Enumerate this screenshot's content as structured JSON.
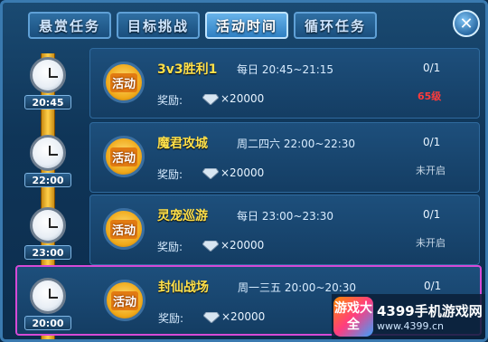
{
  "tabs": [
    {
      "label": "悬赏任务",
      "active": false
    },
    {
      "label": "目标挑战",
      "active": false
    },
    {
      "label": "活动时间",
      "active": true
    },
    {
      "label": "循环任务",
      "active": false
    }
  ],
  "close_label": "✕",
  "badge_text": "活动",
  "reward_label": "奖励:",
  "activities": [
    {
      "time": "20:45",
      "title": "3v3胜利1",
      "schedule": "每日 20:45~21:15",
      "count": "0/1",
      "status": "65级",
      "status_color": "#ff3b3b",
      "reward": "×20000"
    },
    {
      "time": "22:00",
      "title": "魔君攻城",
      "schedule": "周二四六 22:00~22:30",
      "count": "0/1",
      "status": "未开启",
      "status_color": "#c9d9e8",
      "reward": "×20000"
    },
    {
      "time": "23:00",
      "title": "灵宠巡游",
      "schedule": "每日 23:00~23:30",
      "count": "0/1",
      "status": "未开启",
      "status_color": "#c9d9e8",
      "reward": "×20000"
    },
    {
      "time": "20:00",
      "title": "封仙战场",
      "schedule": "周一三五 20:00~20:30",
      "count": "0/1",
      "status": "",
      "status_color": "#c9d9e8",
      "reward": "×20000"
    }
  ],
  "watermark": {
    "logo_text": "游戏大全",
    "line1": "4399手机游戏网",
    "line2": "www.4399.cn"
  },
  "colors": {
    "highlight_border": "#d64ad6",
    "title_yellow": "#ffe04a"
  }
}
